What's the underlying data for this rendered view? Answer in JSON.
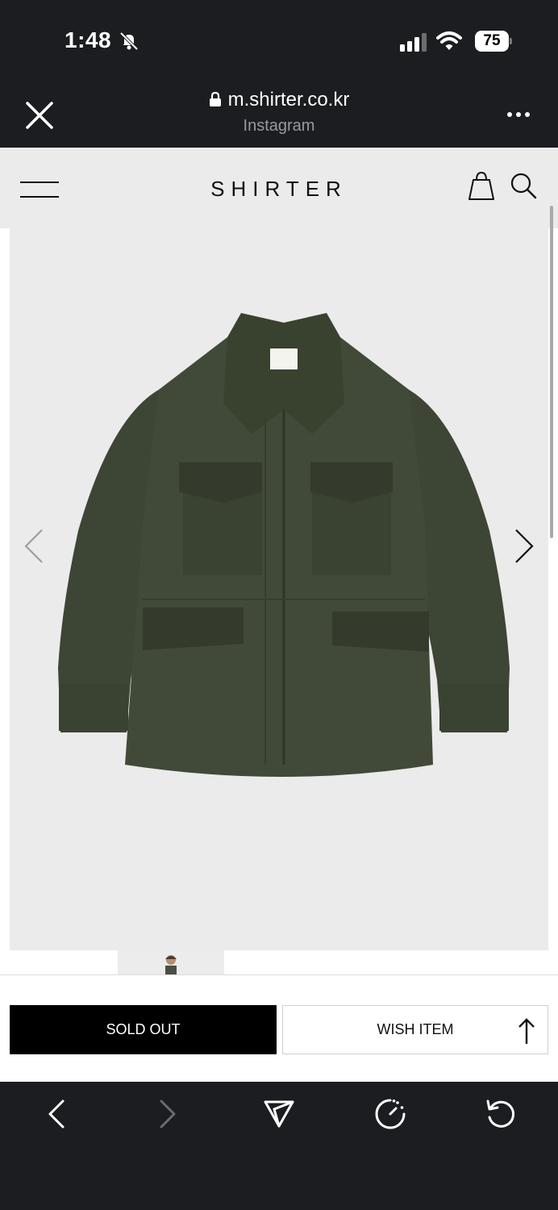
{
  "status_bar": {
    "time": "1:48",
    "battery": "75"
  },
  "browser": {
    "domain": "m.shirter.co.kr",
    "source": "Instagram"
  },
  "site": {
    "brand": "SHIRTER"
  },
  "product": {
    "jacket_color": "#3f4737"
  },
  "actions": {
    "sold_out_label": "SOLD OUT",
    "wish_label": "WISH ITEM"
  },
  "icons": {
    "status": [
      "bell-slash-icon",
      "signal-icon",
      "wifi-icon",
      "battery-icon"
    ],
    "header": [
      "close-icon",
      "lock-icon",
      "more-icon"
    ],
    "site": [
      "menu-icon",
      "bag-icon",
      "search-icon"
    ],
    "gallery": [
      "chevron-left-icon",
      "chevron-right-icon"
    ],
    "toolbar": [
      "back-icon",
      "forward-icon",
      "share-icon",
      "speed-icon",
      "refresh-icon"
    ]
  }
}
